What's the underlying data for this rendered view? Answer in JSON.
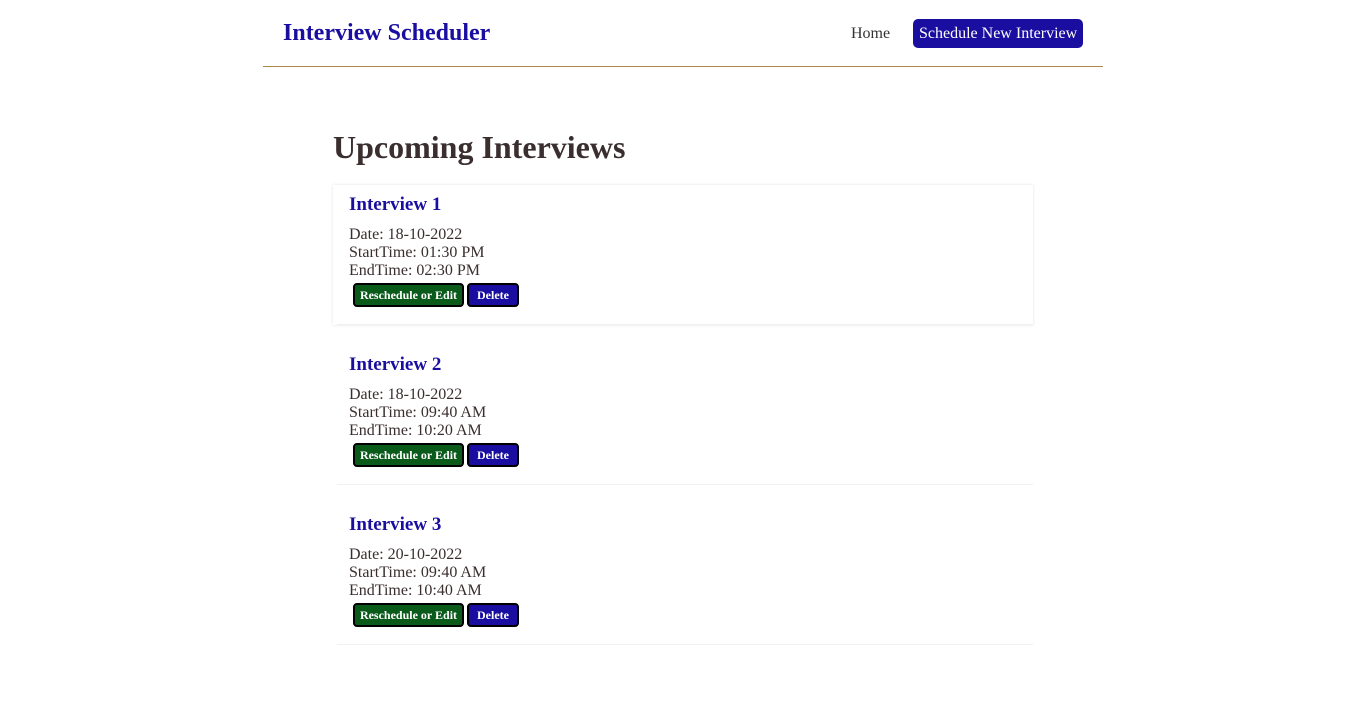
{
  "nav": {
    "brand": "Interview Scheduler",
    "home": "Home",
    "new_interview": "Schedule New Interview"
  },
  "main": {
    "title": "Upcoming Interviews",
    "edit_label": "Reschedule or Edit",
    "delete_label": "Delete"
  },
  "interviews": [
    {
      "title": "Interview 1",
      "date": "Date: 18-10-2022",
      "start": "StartTime: 01:30 PM",
      "end": "EndTime: 02:30 PM"
    },
    {
      "title": "Interview 2",
      "date": "Date: 18-10-2022",
      "start": "StartTime: 09:40 AM",
      "end": "EndTime: 10:20 AM"
    },
    {
      "title": "Interview 3",
      "date": "Date: 20-10-2022",
      "start": "StartTime: 09:40 AM",
      "end": "EndTime: 10:40 AM"
    }
  ],
  "colors": {
    "brand": "#1a0ea0",
    "edit_button": "#0a5a1a",
    "delete_button": "#1a0ea0",
    "nav_border": "#b08a4a"
  }
}
